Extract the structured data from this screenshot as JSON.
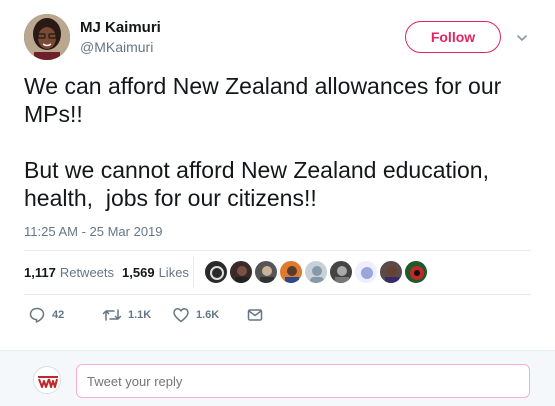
{
  "author": {
    "name": "MJ Kaimuri",
    "handle": "@MKaimuri",
    "follow_label": "Follow"
  },
  "tweet": {
    "paragraphs": [
      "We can afford New Zealand allowances for our MPs!!",
      "But we cannot afford New Zealand education, health,  jobs for our citizens!!"
    ],
    "timestamp": "11:25 AM - 25 Mar 2019"
  },
  "stats": {
    "retweets_count": "1,117",
    "retweets_label": "Retweets",
    "likes_count": "1,569",
    "likes_label": "Likes"
  },
  "actions": {
    "replies": "42",
    "retweets": "1.1K",
    "likes": "1.6K"
  },
  "reply": {
    "placeholder": "Tweet your reply"
  },
  "colors": {
    "accent": "#e0245e",
    "muted": "#657786",
    "text": "#14171a"
  },
  "icons": [
    "chevron-down-icon",
    "reply-icon",
    "retweet-icon",
    "like-icon",
    "message-icon"
  ]
}
